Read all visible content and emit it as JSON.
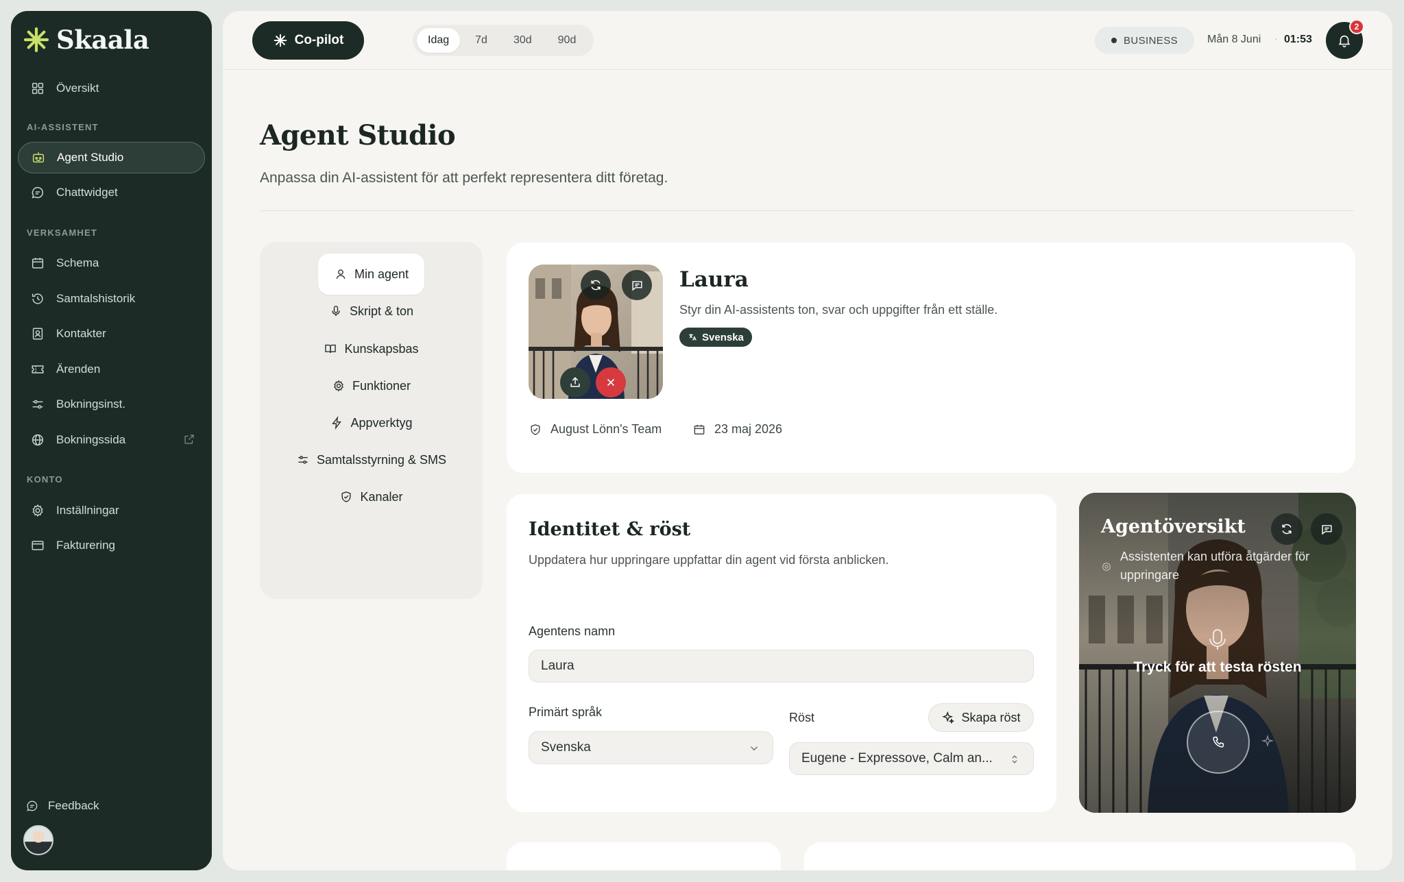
{
  "brand": {
    "name": "Skaala"
  },
  "sidebar": {
    "overview": "Översikt",
    "sections": {
      "ai": "AI-ASSISTENT",
      "business": "VERKSAMHET",
      "account": "KONTO"
    },
    "items": [
      {
        "label": "Agent Studio",
        "icon": "robot-icon"
      },
      {
        "label": "Chattwidget",
        "icon": "chat-icon"
      },
      {
        "label": "Schema",
        "icon": "calendar-icon"
      },
      {
        "label": "Samtalshistorik",
        "icon": "history-icon"
      },
      {
        "label": "Kontakter",
        "icon": "contact-icon"
      },
      {
        "label": "Ärenden",
        "icon": "ticket-icon"
      },
      {
        "label": "Bokningsinst.",
        "icon": "sliders-icon"
      },
      {
        "label": "Bokningssida",
        "icon": "globe-icon"
      },
      {
        "label": "Inställningar",
        "icon": "gear-icon"
      },
      {
        "label": "Fakturering",
        "icon": "billing-icon"
      }
    ],
    "feedback": "Feedback"
  },
  "topbar": {
    "copilot": "Co-pilot",
    "ranges": [
      "Idag",
      "7d",
      "30d",
      "90d"
    ],
    "selected_range": "Idag",
    "plan": "BUSINESS",
    "date": "Mån 8 Juni",
    "time": "01:53",
    "notifications": "2"
  },
  "page": {
    "title": "Agent Studio",
    "subtitle": "Anpassa din AI-assistent för att perfekt representera ditt företag."
  },
  "subnav": [
    "Min agent",
    "Skript & ton",
    "Kunskapsbas",
    "Funktioner",
    "Appverktyg",
    "Samtalsstyrning & SMS",
    "Kanaler"
  ],
  "agent": {
    "name": "Laura",
    "description": "Styr din AI-assistents ton, svar och uppgifter från ett ställe.",
    "language_tag": "Svenska",
    "team": "August Lönn's Team",
    "date": "23 maj 2026"
  },
  "identity": {
    "title": "Identitet & röst",
    "subtitle": "Uppdatera hur uppringare uppfattar din agent vid första anblicken.",
    "name_label": "Agentens namn",
    "name_value": "Laura",
    "language_label": "Primärt språk",
    "language_value": "Svenska",
    "voice_label": "Röst",
    "voice_value": "Eugene - Expressove, Calm an...",
    "create_voice": "Skapa röst"
  },
  "overview": {
    "title": "Agentöversikt",
    "subtitle": "Assistenten kan utföra åtgärder för uppringare",
    "tap_to_test": "Tryck för att testa rösten"
  },
  "colors": {
    "sidebar_bg": "#1d2b26",
    "accent_badge": "#d9343a",
    "logo_star": "#c9e06a",
    "page_bg": "#f6f5f2"
  }
}
